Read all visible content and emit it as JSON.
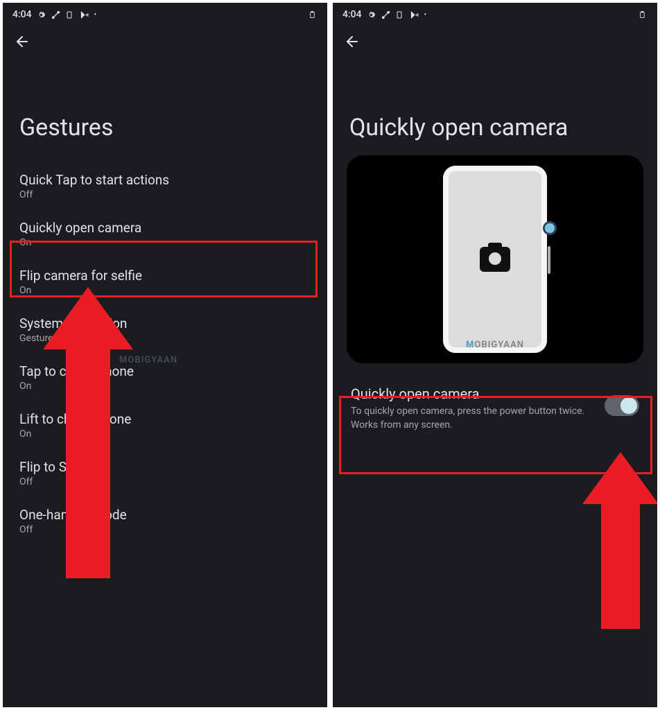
{
  "statusbar": {
    "time": "4:04"
  },
  "left": {
    "title": "Gestures",
    "items": [
      {
        "title": "Quick Tap to start actions",
        "sub": "Off"
      },
      {
        "title": "Quickly open camera",
        "sub": "On"
      },
      {
        "title": "Flip camera for selfie",
        "sub": "On"
      },
      {
        "title": "System navigation",
        "sub": "Gesture navigation"
      },
      {
        "title": "Tap to check phone",
        "sub": "On"
      },
      {
        "title": "Lift to check phone",
        "sub": "On"
      },
      {
        "title": "Flip to Shhh",
        "sub": "Off"
      },
      {
        "title": "One-handed mode",
        "sub": "Off"
      }
    ]
  },
  "right": {
    "title": "Quickly open camera",
    "toggle": {
      "title": "Quickly open camera",
      "desc": "To quickly open camera, press the power button twice. Works from any screen.",
      "on": true
    }
  },
  "watermark": "MOBIGYAAN"
}
